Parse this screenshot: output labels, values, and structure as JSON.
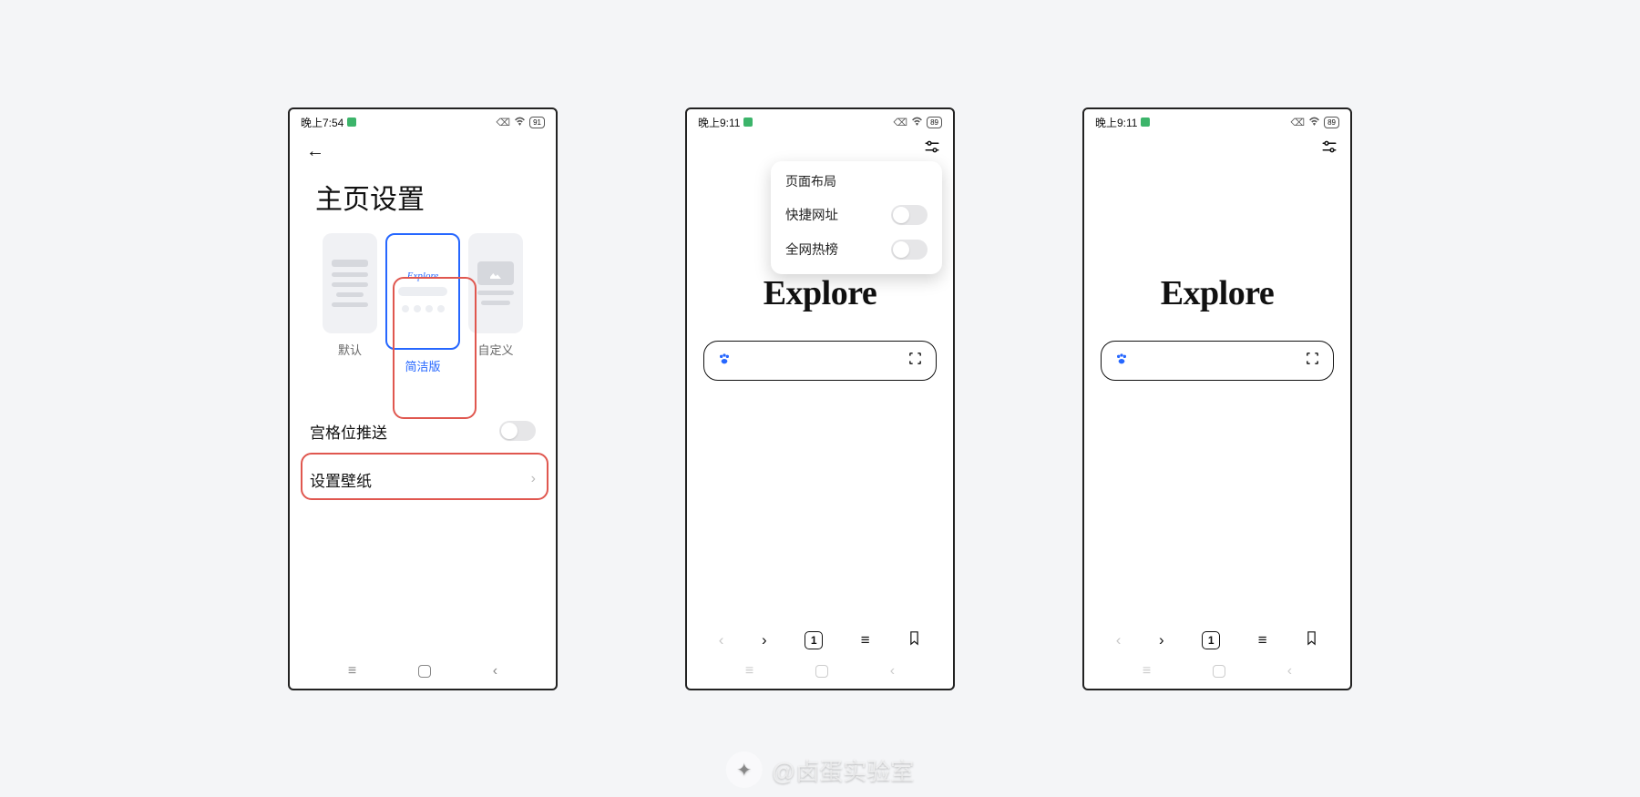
{
  "status": {
    "time_1": "晚上7:54",
    "time_2": "晚上9:11",
    "battery_1": "91",
    "battery_2": "89"
  },
  "screen1": {
    "title": "主页设置",
    "options": {
      "default": "默认",
      "simple": "简洁版",
      "custom": "自定义"
    },
    "preview_brand": "Explore",
    "push_row": "宫格位推送",
    "wallpaper_row": "设置壁纸"
  },
  "screen2": {
    "brand": "Explore",
    "popover_title": "页面布局",
    "popover_quick": "快捷网址",
    "popover_hot": "全网热榜",
    "tab_count": "1"
  },
  "screen3": {
    "brand": "Explore",
    "tab_count": "1"
  },
  "watermark": "@卤蛋实验室"
}
